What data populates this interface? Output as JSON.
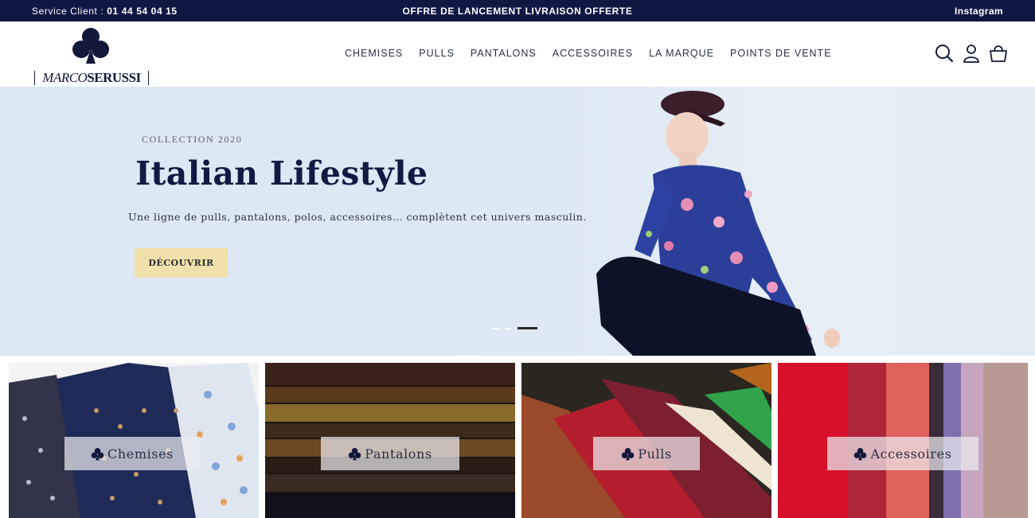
{
  "topbar": {
    "service_prefix": "Service Client : ",
    "service_phone": "01 44 54 04 15",
    "promo": "OFFRE DE LANCEMENT LIVRAISON OFFERTE",
    "instagram": "Instagram"
  },
  "brand": {
    "wordmark_italic": "MARCO",
    "wordmark_bold": "SERUSSI",
    "logo_icon": "club-icon",
    "color": "#13193a"
  },
  "nav": {
    "items": [
      "CHEMISES",
      "PULLS",
      "PANTALONS",
      "ACCESSOIRES",
      "LA MARQUE",
      "POINTS DE VENTE"
    ]
  },
  "header_icons": [
    "search-icon",
    "account-icon",
    "cart-icon"
  ],
  "hero": {
    "kicker": "COLLECTION 2020",
    "title": "Italian Lifestyle",
    "subtitle": "Une ligne de pulls, pantalons, polos, accessoires… complètent cet univers masculin.",
    "cta": "DÉCOUVRIR",
    "slides_total": 3,
    "active_slide": 3
  },
  "categories": [
    {
      "label": "Chemises"
    },
    {
      "label": "Pantalons"
    },
    {
      "label": "Pulls"
    },
    {
      "label": "Accessoires"
    }
  ],
  "colors": {
    "navy": "#0f1743",
    "cta": "#f0e1aa",
    "hero_bg": "#dde9f4"
  }
}
